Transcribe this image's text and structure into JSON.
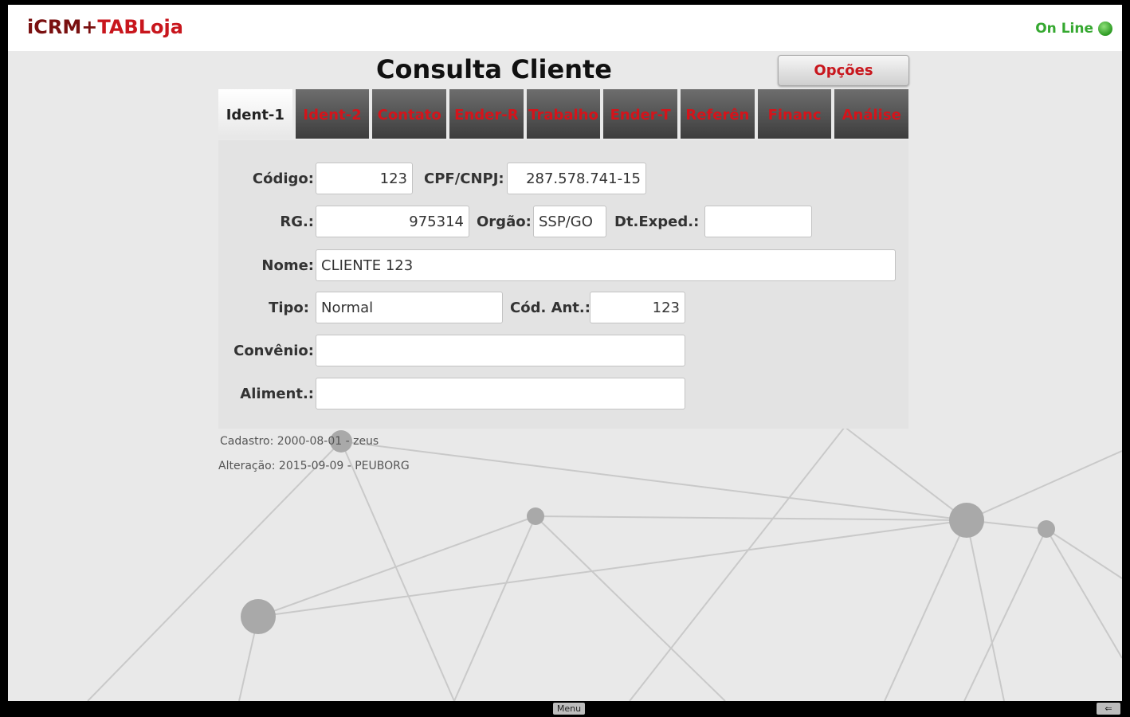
{
  "app": {
    "title_part1": "iCRM+",
    "title_part2": "TABLoja",
    "status_text": "On Line",
    "status_color": "#35a830"
  },
  "page": {
    "title": "Consulta Cliente",
    "options_button": "Opções"
  },
  "tabs": [
    {
      "label": "Ident-1",
      "active": true
    },
    {
      "label": "Ident-2",
      "active": false
    },
    {
      "label": "Contato",
      "active": false
    },
    {
      "label": "Ender-R",
      "active": false
    },
    {
      "label": "Trabalho",
      "active": false
    },
    {
      "label": "Ender-T",
      "active": false
    },
    {
      "label": "Referên",
      "active": false
    },
    {
      "label": "Financ",
      "active": false
    },
    {
      "label": "Análise",
      "active": false
    }
  ],
  "form": {
    "codigo": {
      "label": "Código:",
      "value": "123"
    },
    "cpf_cnpj": {
      "label": "CPF/CNPJ:",
      "value": "287.578.741-15"
    },
    "rg": {
      "label": "RG.:",
      "value": "975314"
    },
    "orgao": {
      "label": "Orgão:",
      "value": "SSP/GO"
    },
    "dt_exped": {
      "label": "Dt.Exped.:",
      "value": ""
    },
    "nome": {
      "label": "Nome:",
      "value": "CLIENTE 123"
    },
    "tipo": {
      "label": "Tipo:",
      "value": "Normal"
    },
    "cod_ant": {
      "label": "Cód. Ant.:",
      "value": "123"
    },
    "convenio": {
      "label": "Convênio:",
      "value": ""
    },
    "aliment": {
      "label": "Aliment.:",
      "value": ""
    }
  },
  "meta": {
    "cadastro": "Cadastro: 2000-08-01 - zeus",
    "alteracao": "Alteração: 2015-09-09 - PEUBORG"
  },
  "nav": {
    "menu_label": "Menu",
    "back_label": "⇐"
  },
  "colors": {
    "accent_red": "#c8161d",
    "tab_dark": "#4a4a4a",
    "background": "#e9e9e9"
  }
}
